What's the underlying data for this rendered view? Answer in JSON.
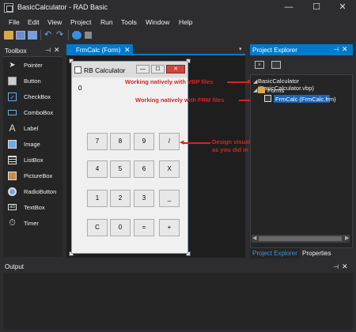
{
  "window": {
    "title": "BasicCalculator - RAD Basic",
    "minimize": "—",
    "maximize": "☐",
    "close": "✕"
  },
  "menu": [
    "File",
    "Edit",
    "View",
    "Project",
    "Run",
    "Tools",
    "Window",
    "Help"
  ],
  "toolbox": {
    "title": "Toolbox",
    "items": [
      {
        "label": "Pointer",
        "icon": "pointer-icon"
      },
      {
        "label": "Button",
        "icon": "button-icon"
      },
      {
        "label": "CheckBox",
        "icon": "checkbox-icon"
      },
      {
        "label": "ComboBox",
        "icon": "combobox-icon"
      },
      {
        "label": "Label",
        "icon": "label-icon"
      },
      {
        "label": "Image",
        "icon": "image-icon"
      },
      {
        "label": "ListBox",
        "icon": "listbox-icon"
      },
      {
        "label": "PictureBox",
        "icon": "picturebox-icon"
      },
      {
        "label": "RadioButton",
        "icon": "radiobutton-icon"
      },
      {
        "label": "TextBox",
        "icon": "textbox-icon"
      },
      {
        "label": "Timer",
        "icon": "timer-icon"
      }
    ]
  },
  "document_tab": {
    "label": "FrmCalc (Form)",
    "close": "✕"
  },
  "form": {
    "title": "RB Calculator",
    "display": "0",
    "keys": [
      [
        "7",
        "8",
        "9",
        "/"
      ],
      [
        "4",
        "5",
        "6",
        "X"
      ],
      [
        "1",
        "2",
        "3",
        "_"
      ],
      [
        "C",
        "0",
        "=",
        "+"
      ]
    ]
  },
  "annotations": {
    "vbp": "Working natively with VBP files",
    "frm": "Working natively with FRM files",
    "design_line1": "Design visually your forms",
    "design_line2": "as you did in VB6"
  },
  "project_explorer": {
    "title": "Project Explorer",
    "project": "BasicCalculator (BasicCalculator.vbp)",
    "folder": "Forms",
    "form_file": "FrmCalc (FrmCalc.frm)",
    "tabs": [
      "Project Explorer",
      "Properties"
    ]
  },
  "output": {
    "title": "Output"
  },
  "colors": {
    "accent": "#007acc",
    "annotation": "#e02020",
    "background": "#2d2d30"
  }
}
